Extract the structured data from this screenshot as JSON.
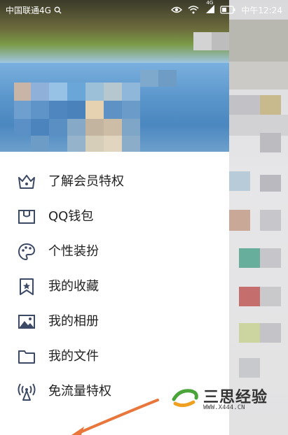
{
  "statusbar": {
    "carrier": "中国联通4G",
    "time": "中午12:24",
    "network_badge": "4G"
  },
  "menu": {
    "items": [
      {
        "label": "了解会员特权",
        "icon": "crown-icon"
      },
      {
        "label": "QQ钱包",
        "icon": "wallet-icon"
      },
      {
        "label": "个性装扮",
        "icon": "palette-icon"
      },
      {
        "label": "我的收藏",
        "icon": "bookmark-star-icon"
      },
      {
        "label": "我的相册",
        "icon": "image-icon"
      },
      {
        "label": "我的文件",
        "icon": "folder-icon"
      },
      {
        "label": "免流量特权",
        "icon": "signal-tower-icon"
      }
    ]
  },
  "watermark": {
    "title": "三思经验",
    "url": "WWW.X444.CN"
  },
  "colors": {
    "icon": "#3d4a66",
    "text": "#222222",
    "arrow": "#e9773c"
  }
}
